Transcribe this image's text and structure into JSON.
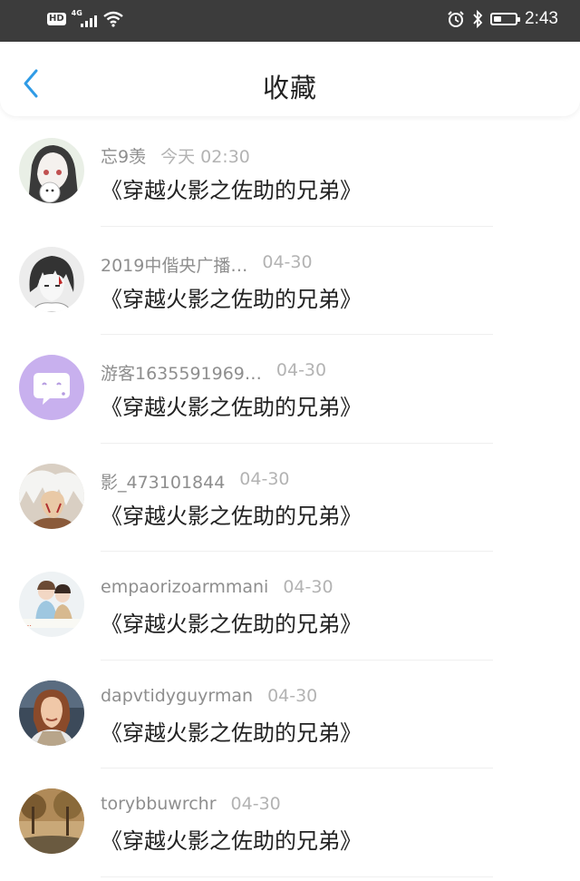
{
  "status_bar": {
    "hd_label": "HD",
    "network_label": "4G",
    "time": "2:43",
    "battery_level": 0.35
  },
  "header": {
    "title": "收藏"
  },
  "items": [
    {
      "name": "忘9羡",
      "time": "今天 02:30",
      "message": "《穿越火影之佐助的兄弟》",
      "avatar": "anime-white-hair-girl"
    },
    {
      "name": "2019中偕央广播…",
      "time": "04-30",
      "message": "《穿越火影之佐助的兄弟》",
      "avatar": "anime-dark-hair-boy"
    },
    {
      "name": "游客1635591969…",
      "time": "04-30",
      "message": "《穿越火影之佐助的兄弟》",
      "avatar": "default-chat-bubble"
    },
    {
      "name": "影_473101844",
      "time": "04-30",
      "message": "《穿越火影之佐助的兄弟》",
      "avatar": "anime-white-hair-man"
    },
    {
      "name": "empaorizoarmmani",
      "time": "04-30",
      "message": "《穿越火影之佐助的兄弟》",
      "avatar": "couple-illustration"
    },
    {
      "name": "dapvtidyguyrman",
      "time": "04-30",
      "message": "《穿越火影之佐助的兄弟》",
      "avatar": "woman-photo"
    },
    {
      "name": "torybbuwrchr",
      "time": "04-30",
      "message": "《穿越火影之佐助的兄弟》",
      "avatar": "autumn-landscape"
    }
  ],
  "colors": {
    "status_bar_bg": "#3c3c3c",
    "back_icon": "#2f9be6",
    "name_text": "#8e8e8e",
    "time_text": "#b3b3b3",
    "message_text": "#222222",
    "default_avatar_bg": "#c8b0ee"
  }
}
